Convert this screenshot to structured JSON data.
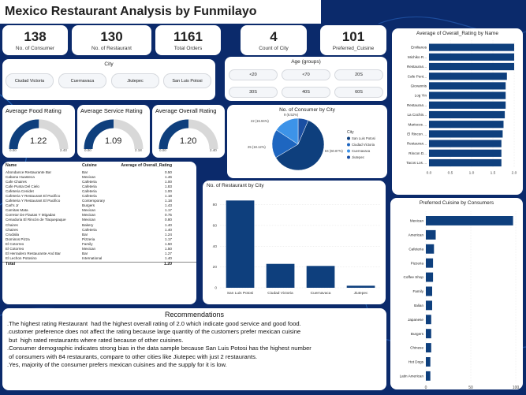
{
  "page": {
    "title": "Mexico Restaurant Analysis by Funmilayo"
  },
  "kpis": [
    {
      "value": "138",
      "label": "No. of Consumer"
    },
    {
      "value": "130",
      "label": "No. of Restaurant"
    },
    {
      "value": "1161",
      "label": "Total Orders"
    },
    {
      "value": "4",
      "label": "Count of City"
    },
    {
      "value": "101",
      "label": "Preferred_Cuisine"
    }
  ],
  "city_slicer": {
    "title": "City",
    "options": [
      "Ciudad Victoria",
      "Cuernavaca",
      "Jiutepec",
      "San Luis Potosi"
    ]
  },
  "age_slicer": {
    "title": "Age (groups)",
    "options": [
      "<20",
      "<70",
      "20S",
      "30S",
      "40S",
      "60S"
    ]
  },
  "gauges": [
    {
      "title": "Average Food Rating",
      "value": "1.22",
      "min": "0.00",
      "max": "2.43",
      "fraction": 0.502
    },
    {
      "title": "Average Service Rating",
      "value": "1.09",
      "min": "0.00",
      "max": "2.18",
      "fraction": 0.5
    },
    {
      "title": "Average Overall Rating",
      "value": "1.20",
      "min": "0.00",
      "max": "2.40",
      "fraction": 0.5
    }
  ],
  "restaurant_table": {
    "headers": [
      "Name",
      "Cuisine",
      "Average of Overall_Rating"
    ],
    "rows": [
      [
        "Abondance Restaurante Bar",
        "Bar",
        "0.50"
      ],
      [
        "Cabana Huasteca",
        "Mexican",
        "1.46"
      ],
      [
        "Cafe Chaires",
        "Cafeteria",
        "1.00"
      ],
      [
        "Cafe Punta Del Cielo",
        "Cafeteria",
        "1.83"
      ],
      [
        "Cafeteria Cenidet",
        "Cafeteria",
        "1.00"
      ],
      [
        "Cafeteria Y Restaurant El Pacifico",
        "Cafeteria",
        "1.18"
      ],
      [
        "Cafeteria Y Restaurant El Pacifico",
        "Contemporary",
        "1.18"
      ],
      [
        "Carl's Jr",
        "Burgers",
        "1.43"
      ],
      [
        "Carnitas Mata",
        "Mexican",
        "1.17"
      ],
      [
        "Cenaduria El Rincón de Tlaquepaque",
        "Mexican",
        "0.80"
      ],
      [
        "Chaires",
        "Bakery",
        "1.40"
      ],
      [
        "Chaires",
        "Cafeteria",
        "1.40"
      ],
      [
        "Crudalia",
        "Bar",
        "1.24"
      ],
      [
        "Dominos Pizza",
        "Pizzeria",
        "1.17"
      ],
      [
        "El Cotorreo",
        "Family",
        "1.50"
      ],
      [
        "El Cotorreo",
        "Mexican",
        "1.50"
      ],
      [
        "El Herradero Restaurante And Bar",
        "Bar",
        "1.27"
      ],
      [
        "El Lechon Potosino",
        "International",
        "1.40"
      ]
    ],
    "hidden_row": [
      "Corretor De Flautas Y Migadas",
      "Mexican",
      "0.75"
    ],
    "total_label": "Total",
    "total_value": "1.20"
  },
  "pie": {
    "title": "No. of Consumer by City",
    "legend_title": "City",
    "labels": [
      "9 (6.52%)",
      "22 (15.94%)",
      "25 (18.12%)",
      "84 (60.87%)"
    ]
  },
  "city_bar": {
    "title": "No. of Restaurant by City"
  },
  "rating_bar": {
    "title": "Average of Overall_Rating by Name"
  },
  "cuisine_bar": {
    "title": "Preferred Cuisine by Consumers"
  },
  "recommendations": {
    "title": "Recommendations",
    "lines": [
      ".The highest rating Restaurant  had the highest overall rating of 2.0 which indicate good service and good food.",
      ".customer preference does not affect the rating because large quantity of the customers prefer mexican cuisine",
      " but  high rated restaurants where rated because of other cuisines.",
      ".Consumer demographic indicates strong bias in the data sample because San Luis Potosi has the highest number",
      " of consumers with 84 restaurants, compare to other cities like Jiutepec with just 2 restaurants.",
      ".Yes, majority of the consumer prefers mexican cuisines and the supply for it is low."
    ]
  },
  "colors": {
    "primary": "#0e3f7d",
    "light": "#3d93e8",
    "mid": "#1e66c0",
    "bg": "#0b2a6b"
  },
  "chart_data": [
    {
      "type": "pie",
      "title": "No. of Consumer by City",
      "legend_title": "City",
      "categories": [
        "San Luis Potosi",
        "Ciudad Victoria",
        "Cuernavaca",
        "Jiutepec"
      ],
      "values": [
        84,
        25,
        22,
        9
      ],
      "percent": [
        60.87,
        18.12,
        15.94,
        6.52
      ],
      "colors": [
        "#0e3f7d",
        "#1e66c0",
        "#3d93e8",
        "#1a4fa3"
      ],
      "legend": "right"
    },
    {
      "type": "bar",
      "title": "No. of Restaurant by City",
      "categories": [
        "San Luis Potosi",
        "Ciudad Victoria",
        "Cuernavaca",
        "Jiutepec"
      ],
      "values": [
        84,
        23,
        21,
        2
      ],
      "ylim": [
        0,
        85
      ],
      "yticks": [
        0,
        20,
        40,
        60,
        80
      ],
      "grid": true
    },
    {
      "type": "bar",
      "orientation": "horizontal",
      "title": "Average of Overall_Rating by Name",
      "categories": [
        "Emilianos",
        "Michiko R...",
        "Restauran...",
        "Cafe Punt...",
        "Giovannis",
        "Log Yin",
        "Restauran...",
        "La Cochin...",
        "Mariscos ...",
        "El Rincon ...",
        "Restauran...",
        "Rincon D...",
        "Tacos Los ..."
      ],
      "values": [
        2.0,
        2.0,
        2.0,
        1.83,
        1.8,
        1.8,
        1.8,
        1.78,
        1.75,
        1.73,
        1.7,
        1.7,
        1.7
      ],
      "xlim": [
        0,
        2.0
      ],
      "xticks": [
        "0.0",
        "0.5",
        "1.0",
        "1.5",
        "2.0"
      ]
    },
    {
      "type": "bar",
      "orientation": "horizontal",
      "title": "Preferred Cuisine by Consumers",
      "categories": [
        "Mexican",
        "American",
        "Cafeteria",
        "Pizzeria",
        "Coffee Shop",
        "Family",
        "Italian",
        "Japanese",
        "Burgers",
        "Chinese",
        "Hot Dogs",
        "Latin American"
      ],
      "values": [
        97,
        11,
        9,
        8,
        8,
        7,
        7,
        6,
        6,
        6,
        5,
        5
      ],
      "xlim": [
        0,
        100
      ],
      "xticks": [
        "0",
        "50",
        "100"
      ]
    }
  ]
}
